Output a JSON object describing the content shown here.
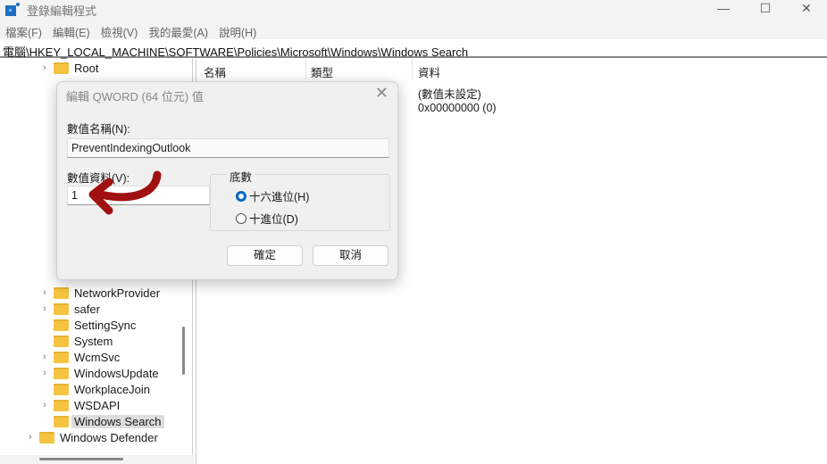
{
  "window": {
    "title": "登錄編輯程式",
    "minimize": "—",
    "maximize": "☐",
    "close": "✕"
  },
  "menu": [
    "檔案(F)",
    "編輯(E)",
    "檢視(V)",
    "我的最愛(A)",
    "說明(H)"
  ],
  "address": "電腦\\HKEY_LOCAL_MACHINE\\SOFTWARE\\Policies\\Microsoft\\Windows\\Windows Search",
  "tree": {
    "top_items": [
      "Root"
    ],
    "bottom_items": [
      "NetworkProvider",
      "safer",
      "SettingSync",
      "System",
      "WcmSvc",
      "WindowsUpdate",
      "WorkplaceJoin",
      "WSDAPI",
      "Windows Search"
    ],
    "selected": "Windows Search",
    "parent_sibling": "Windows Defender"
  },
  "list": {
    "columns": [
      "名稱",
      "類型",
      "資料"
    ],
    "rows": [
      {
        "data": "(數值未設定)"
      },
      {
        "data": "0x00000000 (0)"
      }
    ]
  },
  "dialog": {
    "title": "編輯 QWORD (64 位元) 值",
    "name_label": "數值名稱(N):",
    "name_value": "PreventIndexingOutlook",
    "data_label": "數值資料(V):",
    "data_value": "1",
    "base_label": "底數",
    "base_options": [
      {
        "label": "十六進位(H)",
        "selected": true
      },
      {
        "label": "十進位(D)",
        "selected": false
      }
    ],
    "ok": "確定",
    "cancel": "取消"
  },
  "colors": {
    "accent": "#0067c0",
    "annotation_arrow": "#a01010",
    "folder": "#f5c542"
  }
}
